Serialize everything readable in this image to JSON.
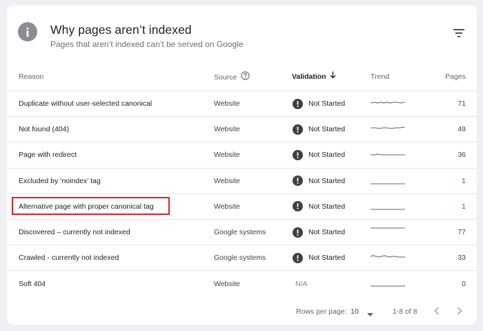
{
  "header": {
    "icon": "info-icon",
    "title": "Why pages aren’t indexed",
    "subtitle": "Pages that aren’t indexed can’t be served on Google",
    "filter_icon": "filter-icon"
  },
  "columns": {
    "reason": "Reason",
    "source": "Source",
    "validation": "Validation",
    "trend": "Trend",
    "pages": "Pages"
  },
  "rows": [
    {
      "reason": "Duplicate without user-selected canonical",
      "source": "Website",
      "validation": "Not Started",
      "pages": "71"
    },
    {
      "reason": "Not found (404)",
      "source": "Website",
      "validation": "Not Started",
      "pages": "49"
    },
    {
      "reason": "Page with redirect",
      "source": "Website",
      "validation": "Not Started",
      "pages": "36"
    },
    {
      "reason": "Excluded by ‘noindex’ tag",
      "source": "Website",
      "validation": "Not Started",
      "pages": "1"
    },
    {
      "reason": "Alternative page with proper canonical tag",
      "source": "Website",
      "validation": "Not Started",
      "pages": "1"
    },
    {
      "reason": "Discovered – currently not indexed",
      "source": "Google systems",
      "validation": "Not Started",
      "pages": "77"
    },
    {
      "reason": "Crawled - currently not indexed",
      "source": "Google systems",
      "validation": "Not Started",
      "pages": "33"
    },
    {
      "reason": "Soft 404",
      "source": "Website",
      "validation": "N/A",
      "pages": "0"
    }
  ],
  "footer": {
    "rows_per_page_label": "Rows per page:",
    "rows_per_page_value": "10",
    "range": "1-8 of 8"
  },
  "colors": {
    "highlight": "#e11d1d",
    "green_count": "#188038"
  }
}
